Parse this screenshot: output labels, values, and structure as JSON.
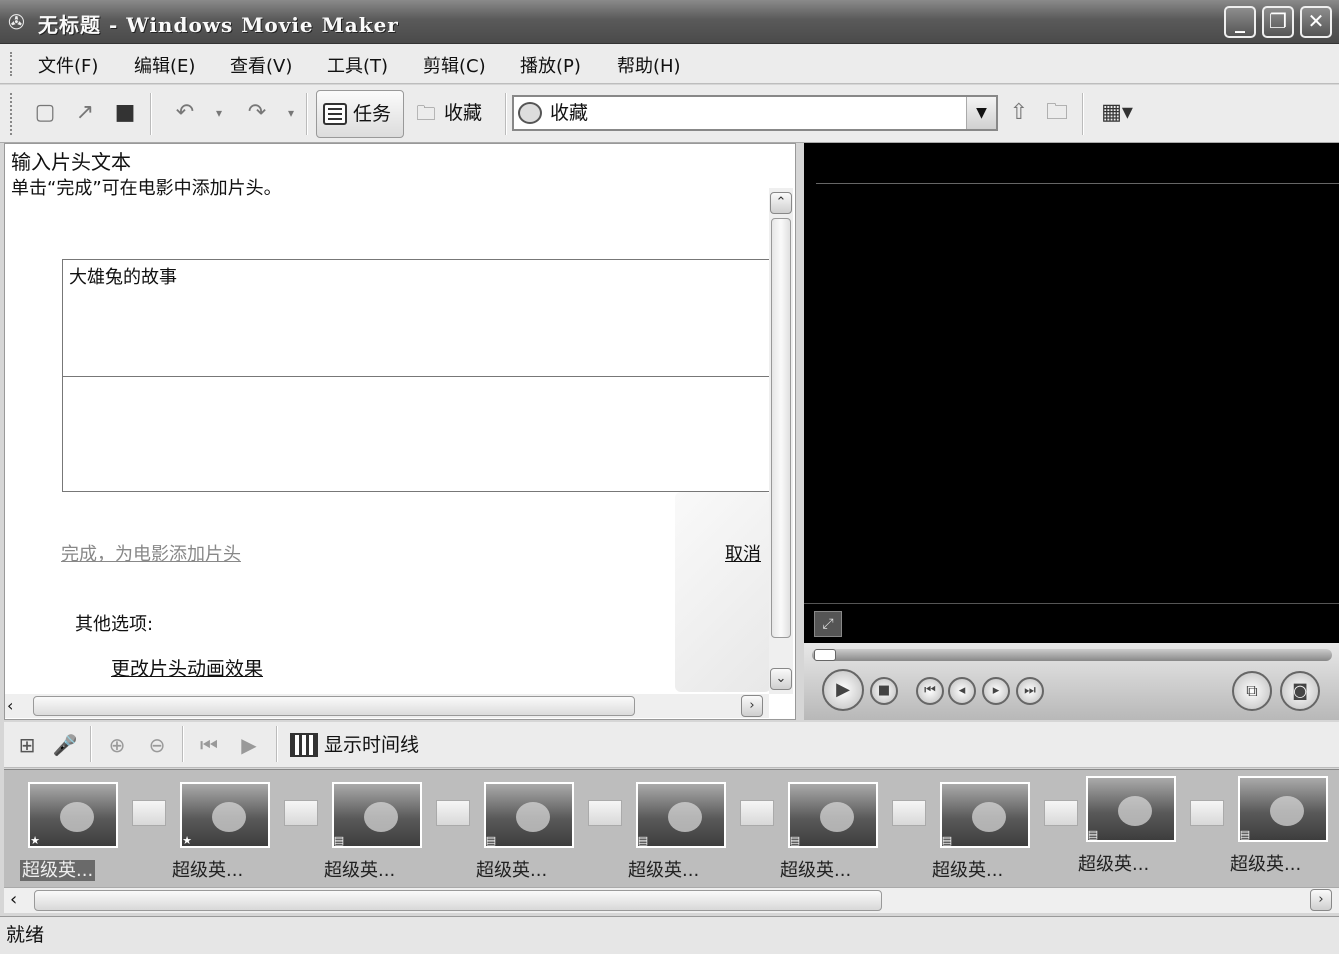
{
  "window": {
    "title": "无标题 - Windows Movie Maker",
    "minimize_label": "_",
    "restore_label": "❐",
    "close_label": "✕"
  },
  "menu": [
    "文件(F)",
    "编辑(E)",
    "查看(V)",
    "工具(T)",
    "剪辑(C)",
    "播放(P)",
    "帮助(H)"
  ],
  "toolbar": {
    "tasks_label": "任务",
    "collections_label": "收藏",
    "collection_select_value": "收藏",
    "icons": [
      "new-file-icon",
      "open-icon",
      "save-icon",
      "undo-icon",
      "redo-icon",
      "up-folder-icon",
      "new-folder-icon",
      "view-options-icon"
    ]
  },
  "task_pane": {
    "heading": "输入片头文本",
    "description": "单击“完成”可在电影中添加片头。",
    "title_text": "大雄兔的故事",
    "subtitle_text": "",
    "done_link": "完成，为电影添加片头",
    "cancel_link": "取消",
    "other_options_label": "其他选项:",
    "change_animation_link": "更改片头动画效果"
  },
  "storyboard_toolbar": {
    "show_timeline_label": "显示时间线"
  },
  "clips": [
    {
      "label": "超级英...",
      "selected": true
    },
    {
      "label": "超级英...",
      "selected": false
    },
    {
      "label": "超级英...",
      "selected": false
    },
    {
      "label": "超级英...",
      "selected": false
    },
    {
      "label": "超级英...",
      "selected": false
    },
    {
      "label": "超级英...",
      "selected": false
    },
    {
      "label": "超级英...",
      "selected": false
    },
    {
      "label": "超级英...",
      "selected": false
    },
    {
      "label": "超级英...",
      "selected": false
    }
  ],
  "status": "就绪"
}
